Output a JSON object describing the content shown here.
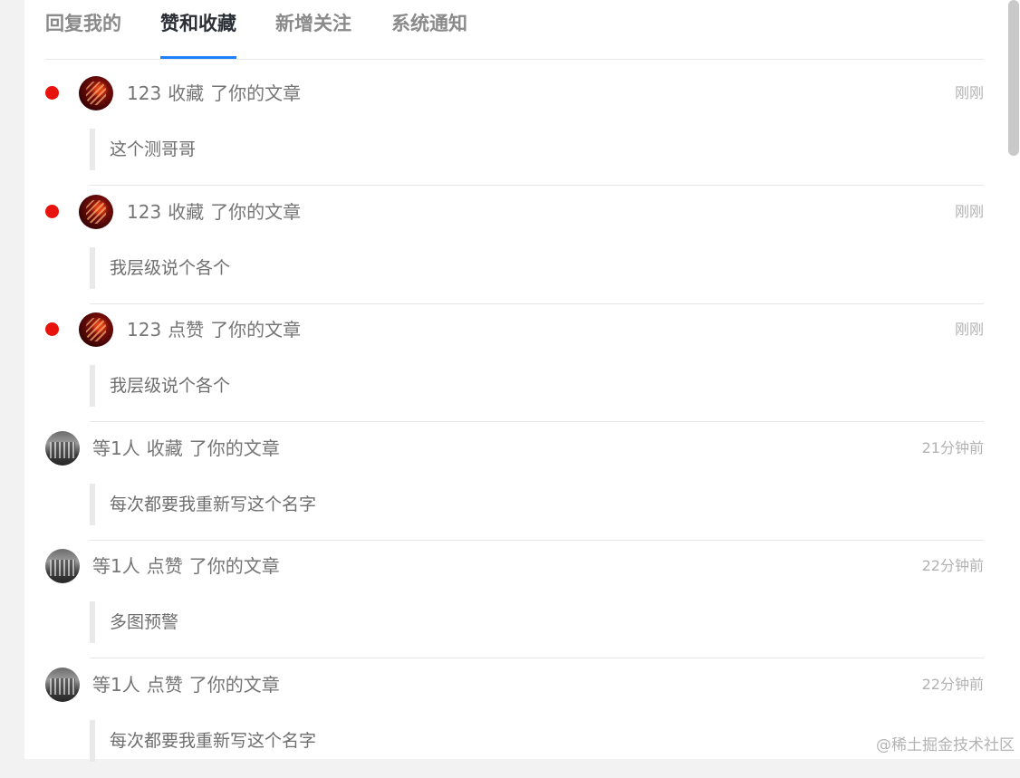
{
  "tabs": [
    {
      "label": "回复我的",
      "active": false
    },
    {
      "label": "赞和收藏",
      "active": true
    },
    {
      "label": "新增关注",
      "active": false
    },
    {
      "label": "系统通知",
      "active": false
    }
  ],
  "notifications": [
    {
      "unread": true,
      "avatar": "red-artwork-avatar",
      "user": "123",
      "action": "收藏",
      "target": "了你的文章",
      "time": "刚刚",
      "content": "这个测哥哥"
    },
    {
      "unread": true,
      "avatar": "red-artwork-avatar",
      "user": "123",
      "action": "收藏",
      "target": "了你的文章",
      "time": "刚刚",
      "content": "我层级说个各个"
    },
    {
      "unread": true,
      "avatar": "red-artwork-avatar",
      "user": "123",
      "action": "点赞",
      "target": "了你的文章",
      "time": "刚刚",
      "content": "我层级说个各个"
    },
    {
      "unread": false,
      "avatar": "building-photo-avatar",
      "user": "等1人",
      "action": "收藏",
      "target": "了你的文章",
      "time": "21分钟前",
      "content": "每次都要我重新写这个名字"
    },
    {
      "unread": false,
      "avatar": "building-photo-avatar",
      "user": "等1人",
      "action": "点赞",
      "target": "了你的文章",
      "time": "22分钟前",
      "content": "多图预警"
    },
    {
      "unread": false,
      "avatar": "building-photo-avatar",
      "user": "等1人",
      "action": "点赞",
      "target": "了你的文章",
      "time": "22分钟前",
      "content": "每次都要我重新写这个名字"
    }
  ],
  "watermark": "@稀土掘金技术社区",
  "colors": {
    "active_tab": "#2b2f36",
    "tab_underline": "#1e80ff",
    "unread_dot": "#e8130d"
  }
}
